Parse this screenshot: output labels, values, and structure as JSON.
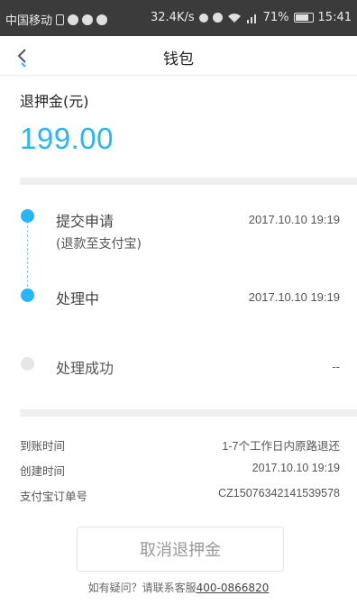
{
  "status_bar": {
    "carrier": "中国移动",
    "speed": "32.4K/s",
    "battery": "71%",
    "time": "15:41"
  },
  "navbar": {
    "title": "钱包"
  },
  "refund": {
    "label": "退押金(元)",
    "amount": "199.00"
  },
  "timeline": [
    {
      "title": "提交申请",
      "subtitle": "(退款至支付宝)",
      "time": "2017.10.10 19:19",
      "state": "done"
    },
    {
      "title": "处理中",
      "subtitle": "",
      "time": "2017.10.10 19:19",
      "state": "done"
    },
    {
      "title": "处理成功",
      "subtitle": "",
      "time": "--",
      "state": "pending"
    }
  ],
  "details": [
    {
      "label": "到账时间",
      "value": "1-7个工作日内原路退还"
    },
    {
      "label": "创建时间",
      "value": "2017.10.10 19:19"
    },
    {
      "label": "支付宝订单号",
      "value": "CZ15076342141539578"
    }
  ],
  "cancel_button": "取消退押金",
  "footer": {
    "text": "如有疑问？请联系客服",
    "phone": "400-0866820"
  },
  "colors": {
    "accent": "#29b6f6",
    "inactive_dot": "#e6e6e6",
    "status_bar": "#3b3b3b"
  }
}
